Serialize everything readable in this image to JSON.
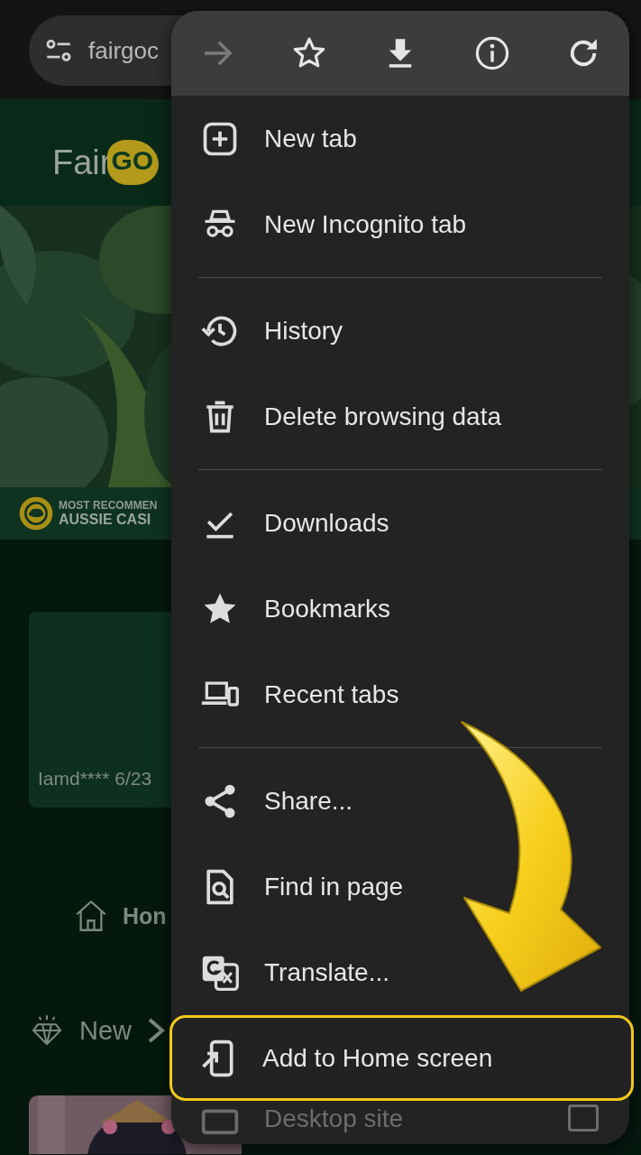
{
  "address_bar": {
    "url": "fairgoc"
  },
  "page": {
    "logo": {
      "word": "Fair",
      "badge": "GO"
    },
    "banner": {
      "line_1": "MOST RECOMMEN",
      "line_2": "AUSSIE CASI"
    },
    "card": {
      "text": "Iamd**** 6/23"
    },
    "nav": {
      "label": "Hon"
    },
    "section": {
      "title": "New"
    }
  },
  "menu": {
    "toolbar": [
      {
        "kind": "forward",
        "disabled": true
      },
      {
        "kind": "star",
        "disabled": false
      },
      {
        "kind": "download",
        "disabled": false
      },
      {
        "kind": "info",
        "disabled": false
      },
      {
        "kind": "reload",
        "disabled": false
      }
    ],
    "sections": [
      [
        {
          "kind": "new-tab",
          "label": "New tab",
          "highlighted": false
        },
        {
          "kind": "incognito",
          "label": "New Incognito tab",
          "highlighted": false
        }
      ],
      [
        {
          "kind": "history",
          "label": "History",
          "highlighted": false
        },
        {
          "kind": "delete",
          "label": "Delete browsing data",
          "highlighted": false
        }
      ],
      [
        {
          "kind": "downloads",
          "label": "Downloads",
          "highlighted": false
        },
        {
          "kind": "bookmarks",
          "label": "Bookmarks",
          "highlighted": false
        },
        {
          "kind": "recent",
          "label": "Recent tabs",
          "highlighted": false
        }
      ],
      [
        {
          "kind": "share",
          "label": "Share...",
          "highlighted": false
        },
        {
          "kind": "find",
          "label": "Find in page",
          "highlighted": false
        },
        {
          "kind": "translate",
          "label": "Translate...",
          "highlighted": false
        },
        {
          "kind": "add-home",
          "label": "Add to Home screen",
          "highlighted": true
        },
        {
          "kind": "desktop",
          "label": "Desktop site",
          "highlighted": false,
          "checked": false
        }
      ]
    ]
  }
}
